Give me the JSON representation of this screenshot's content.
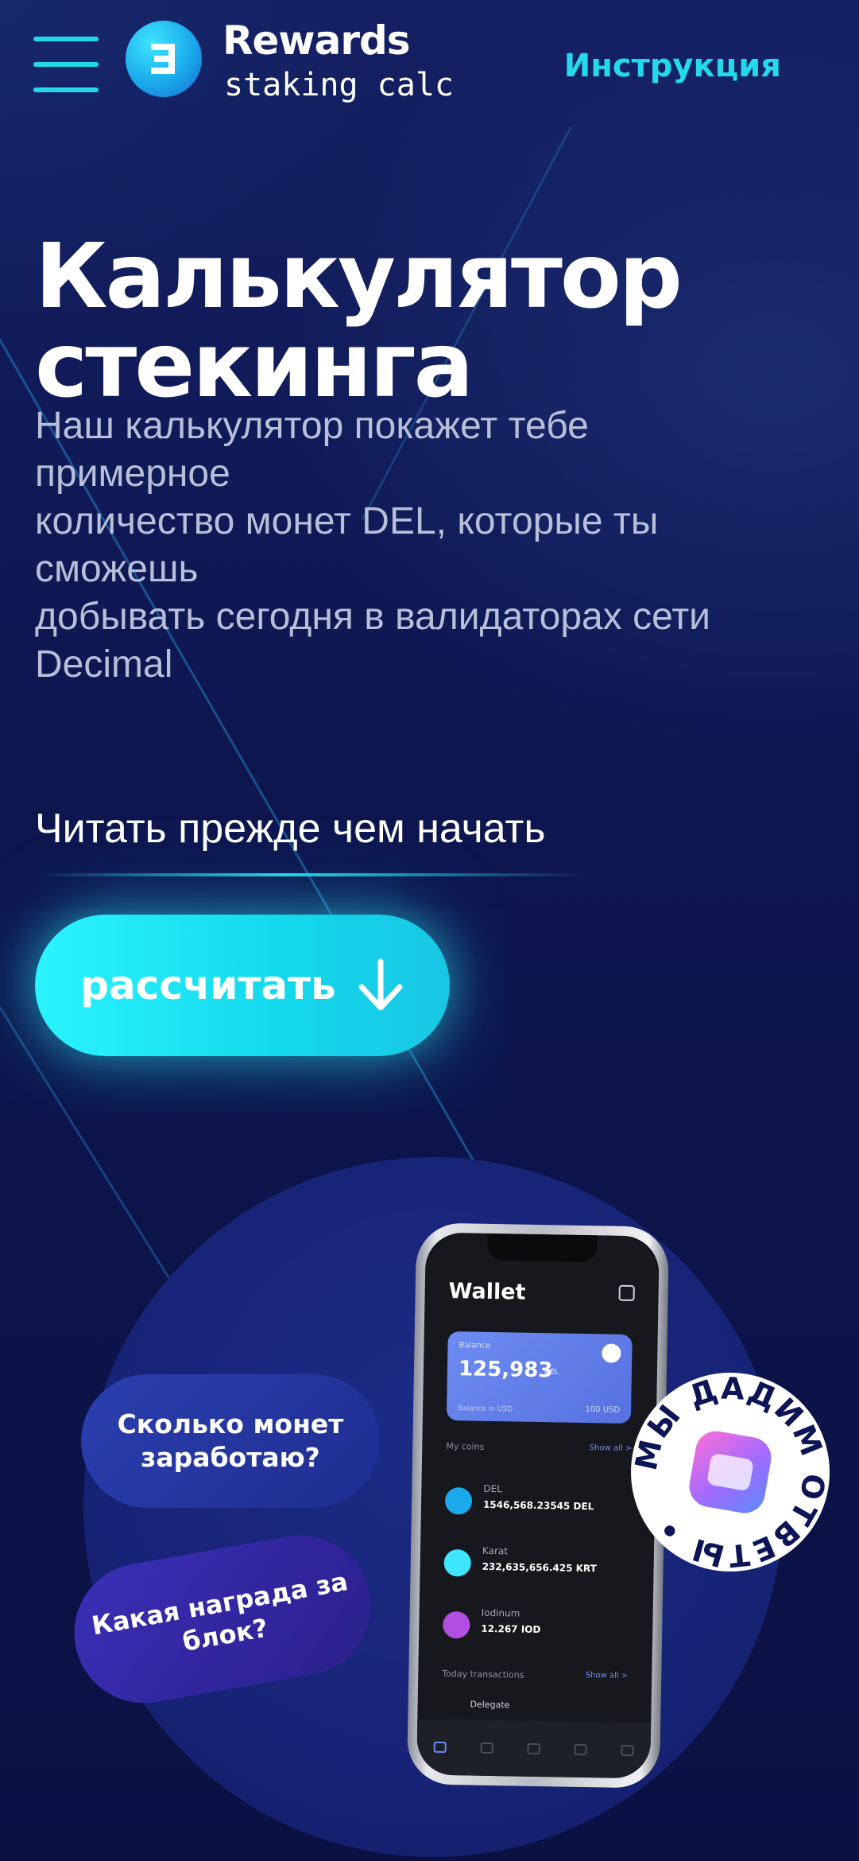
{
  "header": {
    "brand_title": "Rewards",
    "brand_subtitle": "staking calc",
    "instruction_link": "Инструкция",
    "accent_color": "#23d9ec"
  },
  "hero": {
    "title_lines": [
      "Калькулятор",
      "стекинга"
    ],
    "description_lines": [
      "Наш калькулятор покажет тебе",
      "примерное",
      "количество монет DEL, которые ты",
      "сможешь",
      "добывать сегодня в валидаторах сети",
      "Decimal"
    ],
    "read_link": "Читать прежде чем начать",
    "calc_button": "рассчитать",
    "calc_button_icon": "arrow-down-icon"
  },
  "illustration": {
    "bubbles": [
      "Сколько монет\nзаработаю?",
      "Какая награда за\nблок?"
    ],
    "badge_text": "МЫ ДАДИМ ОТВЕТЫ •",
    "phone": {
      "title": "Wallet",
      "balance_label": "Balance",
      "balance_value": "125,983",
      "balance_unit": "DEL",
      "balance_sub": "Balance in USD",
      "balance_usd": "100 USD",
      "my_coins": "My coins",
      "show_all": "Show all >",
      "coins": [
        {
          "name": "DEL",
          "value": "1546,568.23545 DEL",
          "color": "#1aa9ea"
        },
        {
          "name": "Karat",
          "value": "232,635,656.425 KRT",
          "color": "#3ee6ff"
        },
        {
          "name": "Iodinum",
          "value": "12.267 IOD",
          "color": "#b04fe0"
        }
      ],
      "today_transactions": "Today transactions",
      "last_tx": "Delegate"
    }
  }
}
